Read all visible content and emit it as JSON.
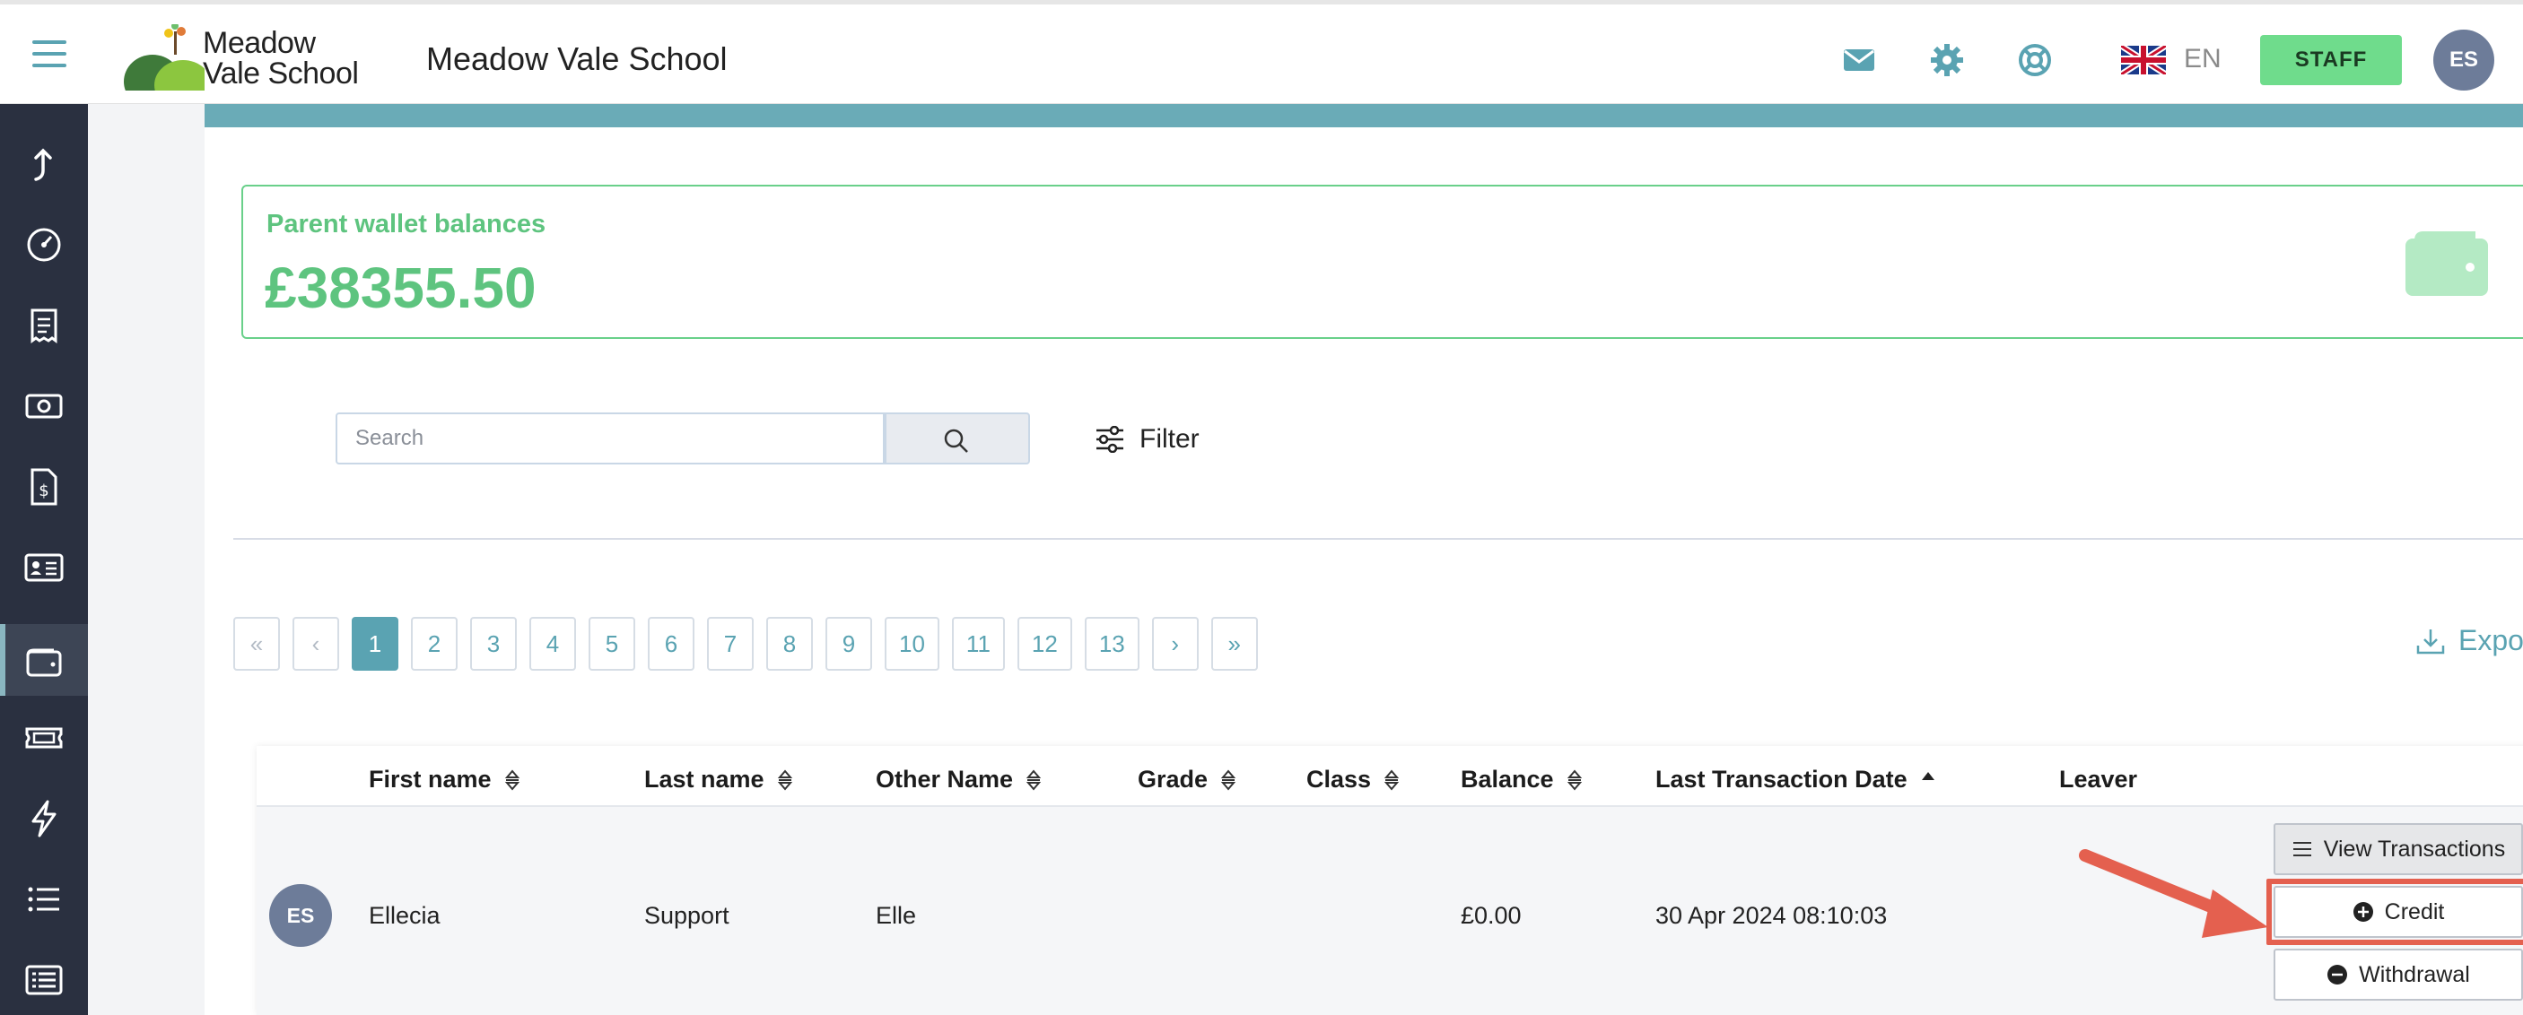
{
  "header": {
    "logo_line1": "Meadow",
    "logo_line2": "Vale School",
    "school_name": "Meadow Vale School",
    "icons": [
      "mail-icon",
      "gear-icon",
      "lifebuoy-icon"
    ],
    "language": "EN",
    "role_button": "STAFF",
    "user_initials": "ES"
  },
  "sidebar": {
    "items": [
      {
        "icon": "upload-arrow-icon"
      },
      {
        "icon": "dashboard-gauge-icon"
      },
      {
        "icon": "receipt-icon"
      },
      {
        "icon": "cash-icon"
      },
      {
        "icon": "invoice-dollar-icon"
      },
      {
        "icon": "id-card-icon"
      },
      {
        "icon": "wallet-icon",
        "active": true
      },
      {
        "icon": "ticket-icon"
      },
      {
        "icon": "lightning-icon"
      },
      {
        "icon": "list-icon"
      },
      {
        "icon": "list-box-icon"
      }
    ]
  },
  "wallet_summary": {
    "label": "Parent wallet balances",
    "value": "£38355.50"
  },
  "search": {
    "placeholder": "Search",
    "filter_label": "Filter"
  },
  "pagination": {
    "first": "«",
    "prev": "‹",
    "pages": [
      "1",
      "2",
      "3",
      "4",
      "5",
      "6",
      "7",
      "8",
      "9",
      "10",
      "11",
      "12",
      "13"
    ],
    "current": "1",
    "next": "›",
    "last": "»"
  },
  "export_label": "Export",
  "table": {
    "columns": [
      "First name",
      "Last name",
      "Other Name",
      "Grade",
      "Class",
      "Balance",
      "Last Transaction Date",
      "Leaver"
    ],
    "rows": [
      {
        "initials": "ES",
        "first_name": "Ellecia",
        "last_name": "Support",
        "other_name": "Elle",
        "grade": "",
        "class": "",
        "balance": "£0.00",
        "last_transaction": "30 Apr 2024 08:10:03",
        "leaver": ""
      }
    ],
    "actions": {
      "view": "View Transactions",
      "credit": "Credit",
      "withdraw": "Withdrawal"
    }
  },
  "colors": {
    "accent_teal": "#5aa3b2",
    "wallet_green": "#5ec47f",
    "staff_green": "#6fdc8c",
    "sidebar_bg": "#2a3040",
    "highlight_red": "#e4604f"
  }
}
